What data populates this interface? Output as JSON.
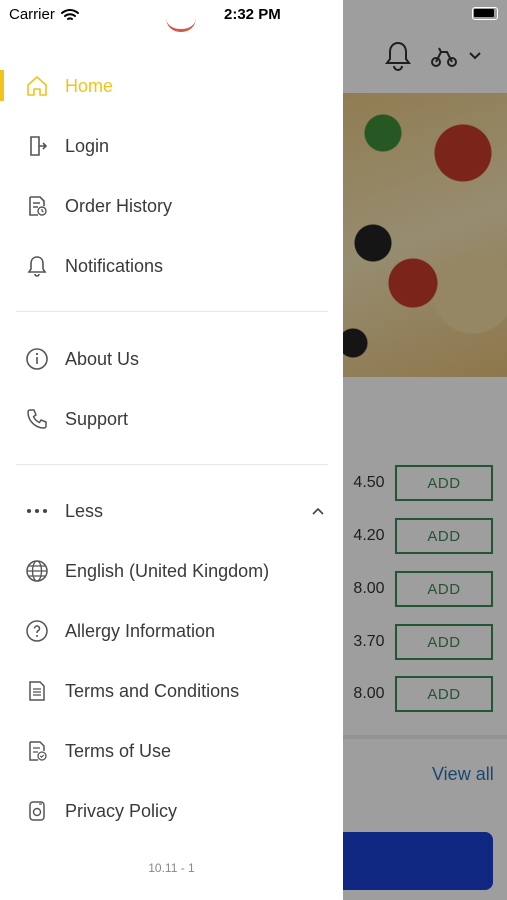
{
  "status_bar": {
    "carrier": "Carrier",
    "time": "2:32 PM"
  },
  "menu": {
    "primary": [
      {
        "label": "Home",
        "icon": "home-icon",
        "active": true
      },
      {
        "label": "Login",
        "icon": "login-icon"
      },
      {
        "label": "Order History",
        "icon": "order-history-icon"
      },
      {
        "label": "Notifications",
        "icon": "bell-icon"
      }
    ],
    "secondary": [
      {
        "label": "About Us",
        "icon": "info-icon"
      },
      {
        "label": "Support",
        "icon": "phone-icon"
      }
    ],
    "more_label": "Less",
    "tertiary": [
      {
        "label": "English (United Kingdom)",
        "icon": "globe-icon"
      },
      {
        "label": "Allergy Information",
        "icon": "question-icon"
      },
      {
        "label": "Terms and Conditions",
        "icon": "document-icon"
      },
      {
        "label": "Terms of Use",
        "icon": "document-check-icon"
      },
      {
        "label": "Privacy Policy",
        "icon": "privacy-icon"
      }
    ]
  },
  "version": "10.11 - 1",
  "background": {
    "prices": [
      "4.50",
      "4.20",
      "8.00",
      "3.70",
      "8.00"
    ],
    "add_label": "ADD",
    "view_all": "View all"
  },
  "colors": {
    "accent": "#f0c419",
    "add_green": "#3a8a55",
    "link_blue": "#2b73b8",
    "cta_blue": "#1a3fd0"
  }
}
